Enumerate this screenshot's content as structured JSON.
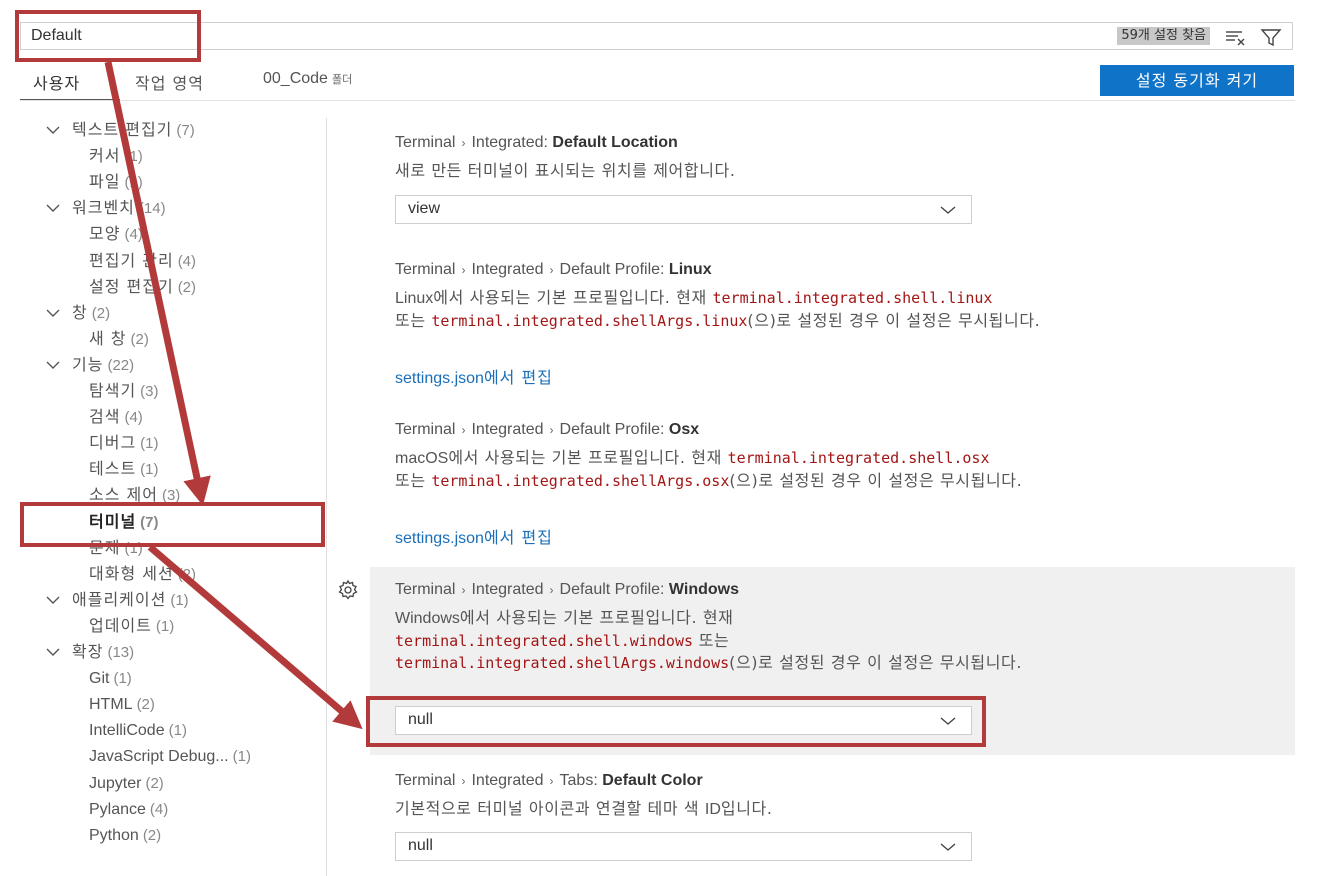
{
  "search": {
    "value": "Default",
    "result_count": "59개 설정 찾음"
  },
  "tabs": {
    "user": "사용자",
    "workspace": "작업 영역",
    "folder_name": "00_Code",
    "folder_suffix": "폴더"
  },
  "sync_button": "설정 동기화 켜기",
  "toc": [
    {
      "label": "텍스트 편집기",
      "count": "(7)",
      "level": 0
    },
    {
      "label": "커서",
      "count": "(1)",
      "level": 1
    },
    {
      "label": "파일",
      "count": "(1)",
      "level": 1
    },
    {
      "label": "워크벤치",
      "count": "(14)",
      "level": 0
    },
    {
      "label": "모양",
      "count": "(4)",
      "level": 1
    },
    {
      "label": "편집기 관리",
      "count": "(4)",
      "level": 1
    },
    {
      "label": "설정 편집기",
      "count": "(2)",
      "level": 1
    },
    {
      "label": "창",
      "count": "(2)",
      "level": 0
    },
    {
      "label": "새 창",
      "count": "(2)",
      "level": 1
    },
    {
      "label": "기능",
      "count": "(22)",
      "level": 0
    },
    {
      "label": "탐색기",
      "count": "(3)",
      "level": 1
    },
    {
      "label": "검색",
      "count": "(4)",
      "level": 1
    },
    {
      "label": "디버그",
      "count": "(1)",
      "level": 1
    },
    {
      "label": "테스트",
      "count": "(1)",
      "level": 1
    },
    {
      "label": "소스 제어",
      "count": "(3)",
      "level": 1
    },
    {
      "label": "터미널",
      "count": "(7)",
      "level": 1,
      "active": true
    },
    {
      "label": "문제",
      "count": "(1)",
      "level": 1
    },
    {
      "label": "대화형 세션",
      "count": "(2)",
      "level": 1
    },
    {
      "label": "애플리케이션",
      "count": "(1)",
      "level": 0
    },
    {
      "label": "업데이트",
      "count": "(1)",
      "level": 1
    },
    {
      "label": "확장",
      "count": "(13)",
      "level": 0
    },
    {
      "label": "Git",
      "count": "(1)",
      "level": 1
    },
    {
      "label": "HTML",
      "count": "(2)",
      "level": 1
    },
    {
      "label": "IntelliCode",
      "count": "(1)",
      "level": 1
    },
    {
      "label": "JavaScript Debug...",
      "count": "(1)",
      "level": 1
    },
    {
      "label": "Jupyter",
      "count": "(2)",
      "level": 1
    },
    {
      "label": "Pylance",
      "count": "(4)",
      "level": 1
    },
    {
      "label": "Python",
      "count": "(2)",
      "level": 1
    }
  ],
  "settings": {
    "default_location": {
      "prefix": "Terminal",
      "group": "Integrated:",
      "name": "Default Location",
      "desc": "새로 만든 터미널이 표시되는 위치를 제어합니다.",
      "value": "view"
    },
    "profile_linux": {
      "prefix": "Terminal",
      "group": "Integrated",
      "sub": "Default Profile:",
      "name": "Linux",
      "desc_a": "Linux",
      "desc_b": "에서 사용되는 기본 프로필입니다. 현재 ",
      "code1": "terminal.integrated.shell.linux",
      "desc_c": "또는 ",
      "code2": "terminal.integrated.shellArgs.linux",
      "desc_d": "(으)로 설정된 경우 이 설정은 무시됩니다.",
      "link_a": "settings.json",
      "link_b": "에서 편집"
    },
    "profile_osx": {
      "prefix": "Terminal",
      "group": "Integrated",
      "sub": "Default Profile:",
      "name": "Osx",
      "desc_a": "macOS",
      "desc_b": "에서 사용되는 기본 프로필입니다. 현재 ",
      "code1": "terminal.integrated.shell.osx",
      "desc_c": "또는 ",
      "code2": "terminal.integrated.shellArgs.osx",
      "desc_d": "(으)로 설정된 경우 이 설정은 무시됩니다.",
      "link_a": "settings.json",
      "link_b": "에서 편집"
    },
    "profile_windows": {
      "prefix": "Terminal",
      "group": "Integrated",
      "sub": "Default Profile:",
      "name": "Windows",
      "desc_a": "Windows",
      "desc_b": "에서 사용되는 기본 프로필입니다. 현재",
      "code1": "terminal.integrated.shell.windows",
      "desc_c": " 또는",
      "code2": "terminal.integrated.shellArgs.windows",
      "desc_d": "(으)로 설정된 경우 이 설정은 무시됩니다.",
      "value": "null"
    },
    "tabs_default_color": {
      "prefix": "Terminal",
      "group": "Integrated",
      "sub": "Tabs:",
      "name": "Default Color",
      "desc_a": "기본적으로 터미널 아이콘과 연결할 테마 색 ",
      "desc_b": "ID",
      "desc_c": "입니다.",
      "value": "null"
    }
  },
  "colors": {
    "accent": "#0f73c8",
    "annotation": "#b33a3a",
    "code": "#a31515",
    "link": "#1a6fb8"
  }
}
